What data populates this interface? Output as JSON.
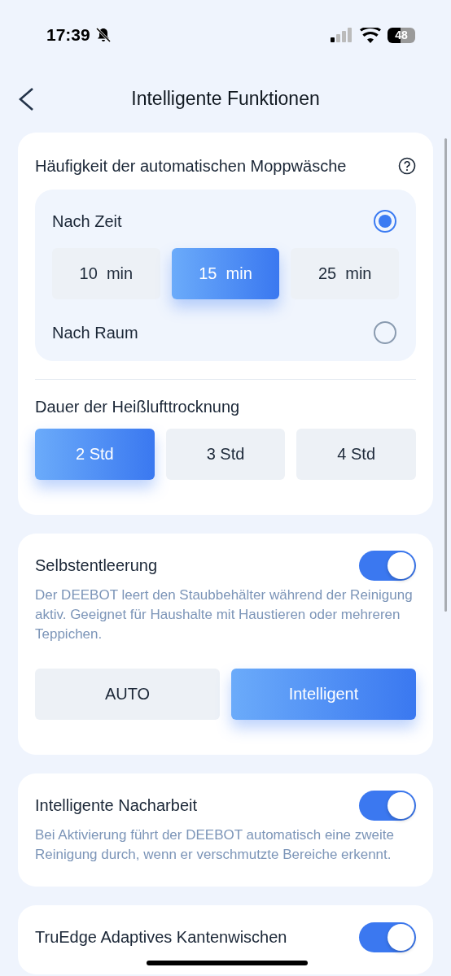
{
  "status_bar": {
    "time": "17:39",
    "battery": "48"
  },
  "header": {
    "title": "Intelligente Funktionen"
  },
  "mop_wash": {
    "title": "Häufigkeit der automatischen Moppwäsche",
    "options": [
      {
        "label": "Nach Zeit",
        "selected": true,
        "choices": [
          {
            "label": "10  min",
            "selected": false
          },
          {
            "label": "15  min",
            "selected": true
          },
          {
            "label": "25  min",
            "selected": false
          }
        ]
      },
      {
        "label": "Nach Raum",
        "selected": false
      }
    ]
  },
  "drying": {
    "title": "Dauer der Heißlufttrocknung",
    "choices": [
      {
        "label": "2 Std",
        "selected": true
      },
      {
        "label": "3 Std",
        "selected": false
      },
      {
        "label": "4 Std",
        "selected": false
      }
    ]
  },
  "features": [
    {
      "title": "Selbstentleerung",
      "on": true,
      "description": "Der DEEBOT leert den Staubbehälter während der Reinigung aktiv. Geeignet für Haushalte mit Haustieren oder mehreren Teppichen.",
      "choices": [
        {
          "label": "AUTO",
          "selected": false
        },
        {
          "label": "Intelligent",
          "selected": true
        }
      ]
    },
    {
      "title": "Intelligente Nacharbeit",
      "on": true,
      "description": "Bei Aktivierung führt der DEEBOT automatisch eine zweite Reinigung durch, wenn er verschmutzte Bereiche erkennt."
    },
    {
      "title": "TruEdge Adaptives Kantenwischen",
      "on": true
    }
  ]
}
